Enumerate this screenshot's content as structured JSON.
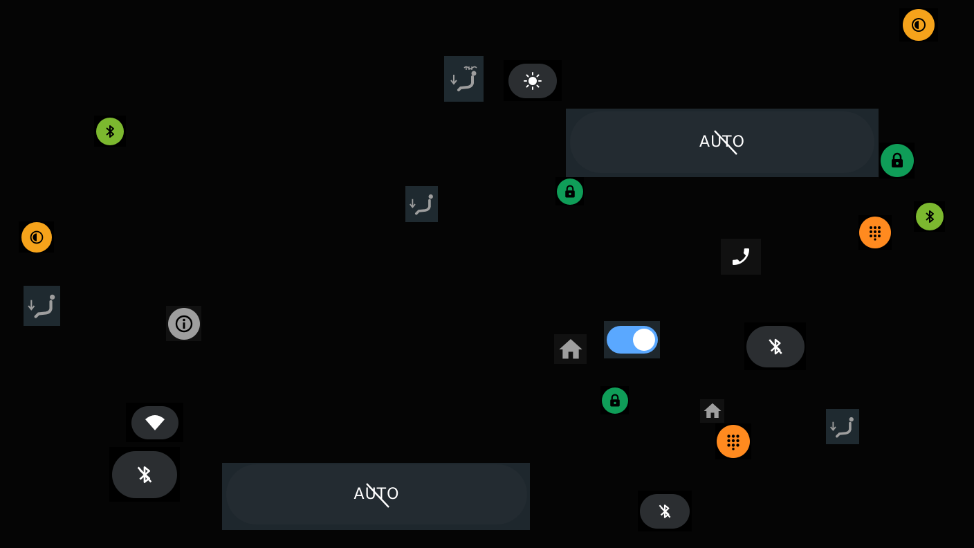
{
  "auto_buttons": [
    {
      "label": "AUTO"
    },
    {
      "label": "AUTO"
    }
  ],
  "colors": {
    "background": "#050505",
    "bluetooth_green": "#7cb82f",
    "lock_green": "#0f9d58",
    "brightness_orange": "#f6a31b",
    "dialpad_orange": "#ff8a1f",
    "toggle_blue": "#5aa8ff",
    "pill_gray": "#2b2e31",
    "seat_bg": "#1f2a30",
    "icon_gray": "#9e9e9e"
  },
  "icons": [
    "brightness-auto-icon",
    "seat-heat-icon",
    "brightness-icon",
    "bluetooth-icon",
    "lock-icon",
    "seat-icon",
    "dialpad-icon",
    "phone-icon",
    "info-icon",
    "home-icon",
    "toggle-switch",
    "bluetooth-off-icon",
    "wifi-icon"
  ],
  "toggle": {
    "on": true
  }
}
